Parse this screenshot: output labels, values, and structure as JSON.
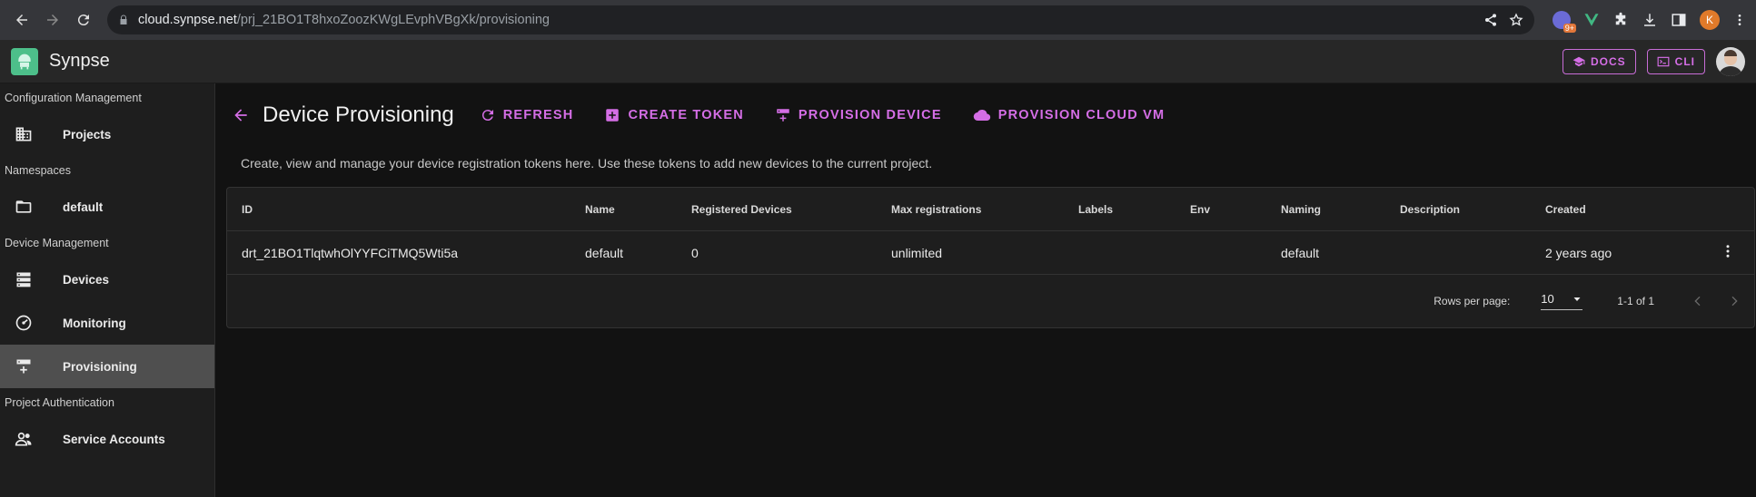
{
  "browser": {
    "url_host": "cloud.synpse.net",
    "url_path": "/prj_21BO1T8hxoZoozKWgLEvphVBgXk/provisioning",
    "ext_badge": "9+",
    "profile_initial": "K"
  },
  "header": {
    "app_name": "Synpse",
    "docs_label": "DOCS",
    "cli_label": "CLI"
  },
  "sidebar": {
    "sections": [
      {
        "title": "Configuration Management",
        "items": [
          {
            "label": "Projects",
            "icon": "building-icon"
          }
        ]
      },
      {
        "title": "Namespaces",
        "items": [
          {
            "label": "default",
            "icon": "folder-icon"
          }
        ]
      },
      {
        "title": "Device Management",
        "items": [
          {
            "label": "Devices",
            "icon": "server-icon"
          },
          {
            "label": "Monitoring",
            "icon": "gauge-icon"
          },
          {
            "label": "Provisioning",
            "icon": "provision-icon",
            "active": true
          }
        ]
      },
      {
        "title": "Project Authentication",
        "items": [
          {
            "label": "Service Accounts",
            "icon": "people-icon"
          }
        ]
      }
    ]
  },
  "page": {
    "title": "Device Provisioning",
    "actions": {
      "refresh": "REFRESH",
      "create_token": "CREATE TOKEN",
      "provision_device": "PROVISION DEVICE",
      "provision_cloud_vm": "PROVISION CLOUD VM"
    },
    "description": "Create, view and manage your device registration tokens here. Use these tokens to add new devices to the current project."
  },
  "table": {
    "columns": [
      "ID",
      "Name",
      "Registered Devices",
      "Max registrations",
      "Labels",
      "Env",
      "Naming",
      "Description",
      "Created"
    ],
    "rows": [
      {
        "id": "drt_21BO1TlqtwhOlYYFCiTMQ5Wti5a",
        "name": "default",
        "registered": "0",
        "max": "unlimited",
        "labels": "",
        "env": "",
        "naming": "default",
        "description": "",
        "created": "2 years ago"
      }
    ],
    "footer": {
      "rows_per_page_label": "Rows per page:",
      "rows_per_page": "10",
      "range": "1-1 of 1"
    }
  },
  "colors": {
    "accent": "#d56ee6",
    "logo": "#4dbf8a"
  }
}
